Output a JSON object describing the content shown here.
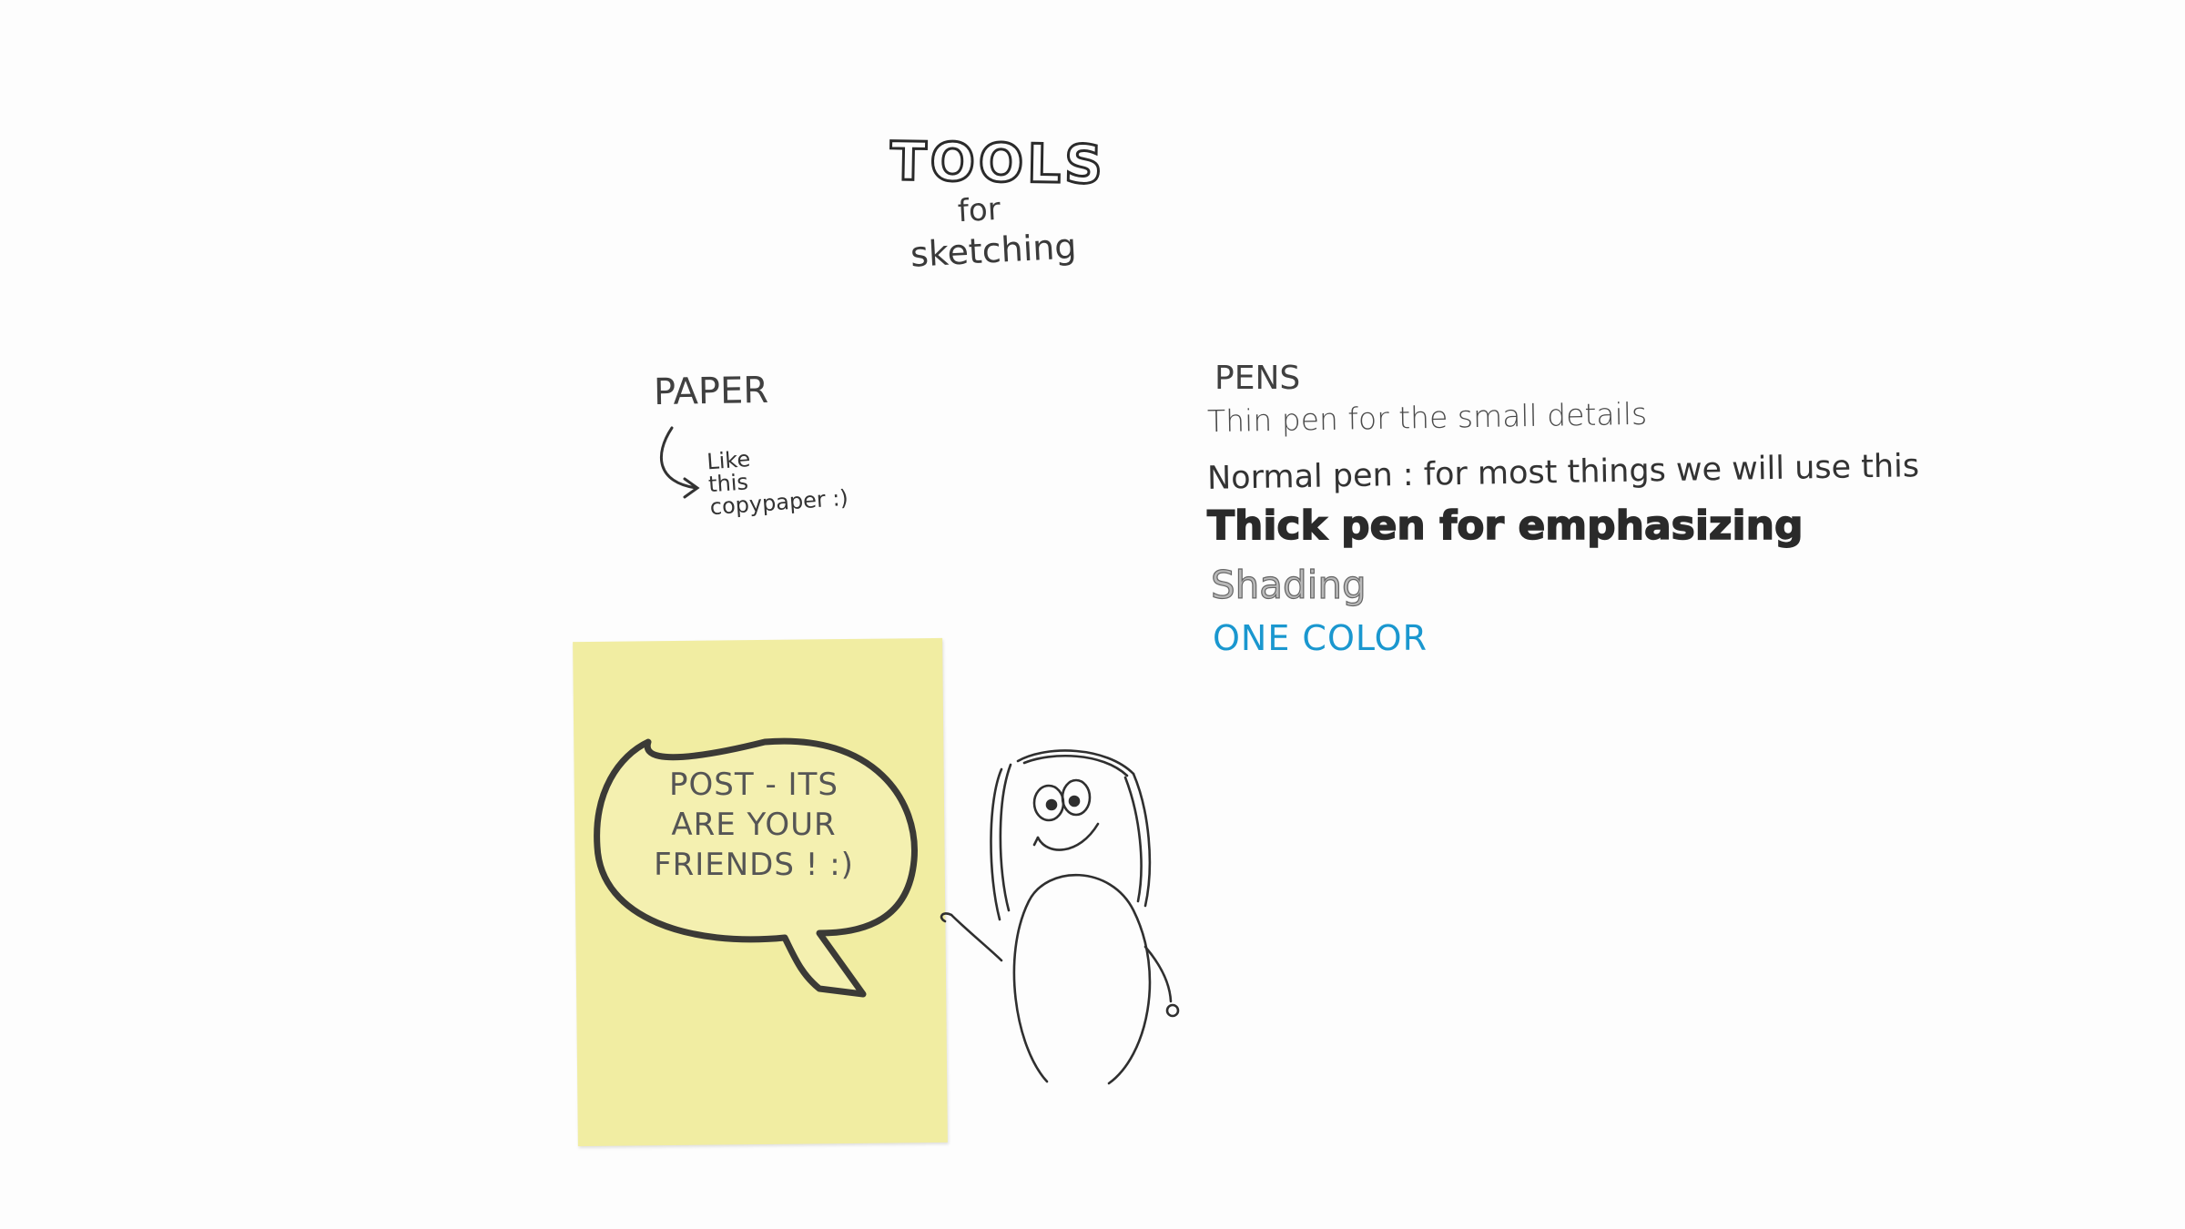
{
  "title": {
    "main": "TOOLS",
    "for": "for",
    "sketching": "sketching"
  },
  "paper": {
    "heading": "PAPER",
    "note": "Like\nthis\ncopypaper :)"
  },
  "pens": {
    "heading": "PENS",
    "thin": "Thin pen for the small details",
    "normal": "Normal pen : for most things we will use this",
    "thick": "Thick pen for emphasizing",
    "shading": "Shading",
    "color": "ONE COLOR"
  },
  "postit": {
    "bubble_text": "POST - ITS\nARE YOUR\nFRIENDS ! :)"
  },
  "colors": {
    "postit": "#f1eda2",
    "accent_blue": "#1a97cf",
    "ink": "#2d2d2d"
  }
}
